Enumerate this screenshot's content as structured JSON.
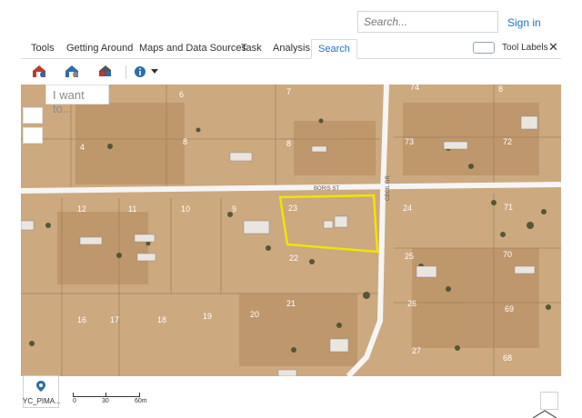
{
  "header": {
    "search_placeholder": "Search...",
    "signin_label": "Sign in"
  },
  "tabs": [
    {
      "label": "Tools"
    },
    {
      "label": "Getting Around"
    },
    {
      "label": "Maps and Data Sources"
    },
    {
      "label": "Task"
    },
    {
      "label": "Analysis"
    },
    {
      "label": "Search",
      "active": true
    }
  ],
  "tool_labels_toggle": {
    "label": "Tool Labels",
    "on": false
  },
  "toolbar_icons": [
    "house-search-icon",
    "house-buffer-icon",
    "parcel-select-icon",
    "info-icon"
  ],
  "map": {
    "i_want_to_placeholder": "I want to...",
    "street_labels": {
      "boris_st": "BORIS ST",
      "cecil_dr": "CECIL DR"
    },
    "lot_numbers": [
      "6",
      "7",
      "74",
      "8",
      "4",
      "8",
      "8",
      "73",
      "72",
      "12",
      "11",
      "10",
      "9",
      "23",
      "24",
      "71",
      "70",
      "22",
      "25",
      "21",
      "26",
      "16",
      "17",
      "18",
      "19",
      "20",
      "27",
      "68",
      "69"
    ],
    "highlight_color": "#f1e400",
    "road_color": "#f5f5f5"
  },
  "basemap": {
    "label": "YC_PIMA..."
  },
  "scale": {
    "labels": [
      "0",
      "30",
      "60m"
    ]
  }
}
